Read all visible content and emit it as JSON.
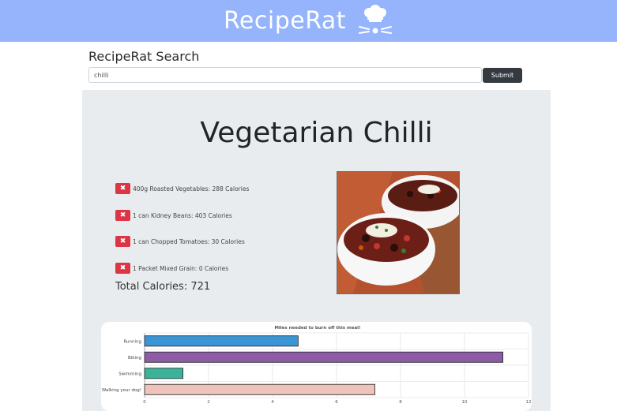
{
  "header": {
    "brand": "RecipeRat",
    "logo_icon": "chef-hat-mouse-icon"
  },
  "search": {
    "heading": "RecipeRat Search",
    "value": "chilli",
    "submit_label": "Submit"
  },
  "recipe": {
    "title": "Vegetarian Chilli",
    "image_alt": "Bowls of vegetarian chilli",
    "ingredients": [
      {
        "text": "400g Roasted Vegetables: 288 Calories"
      },
      {
        "text": "1 can Kidney Beans: 403 Calories"
      },
      {
        "text": "1 can Chopped Tomatoes: 30 Calories"
      },
      {
        "text": "1 Packet Mixed Grain: 0 Calories"
      }
    ],
    "remove_glyph": "✖",
    "total": "Total Calories: 721"
  },
  "chart_data": {
    "type": "bar",
    "orientation": "horizontal",
    "title": "Miles needed to burn off this meal!",
    "categories": [
      "Running",
      "Biking",
      "Swimming",
      "Walking your dog!"
    ],
    "values": [
      4.8,
      11.2,
      1.2,
      7.2
    ],
    "colors": [
      "#3b95d4",
      "#8e5ba6",
      "#3bb39a",
      "#edc3bb"
    ],
    "xlim": [
      0,
      12
    ],
    "xticks": [
      0,
      2,
      4,
      6,
      8,
      10,
      12
    ],
    "grid": true,
    "legend": "none"
  }
}
